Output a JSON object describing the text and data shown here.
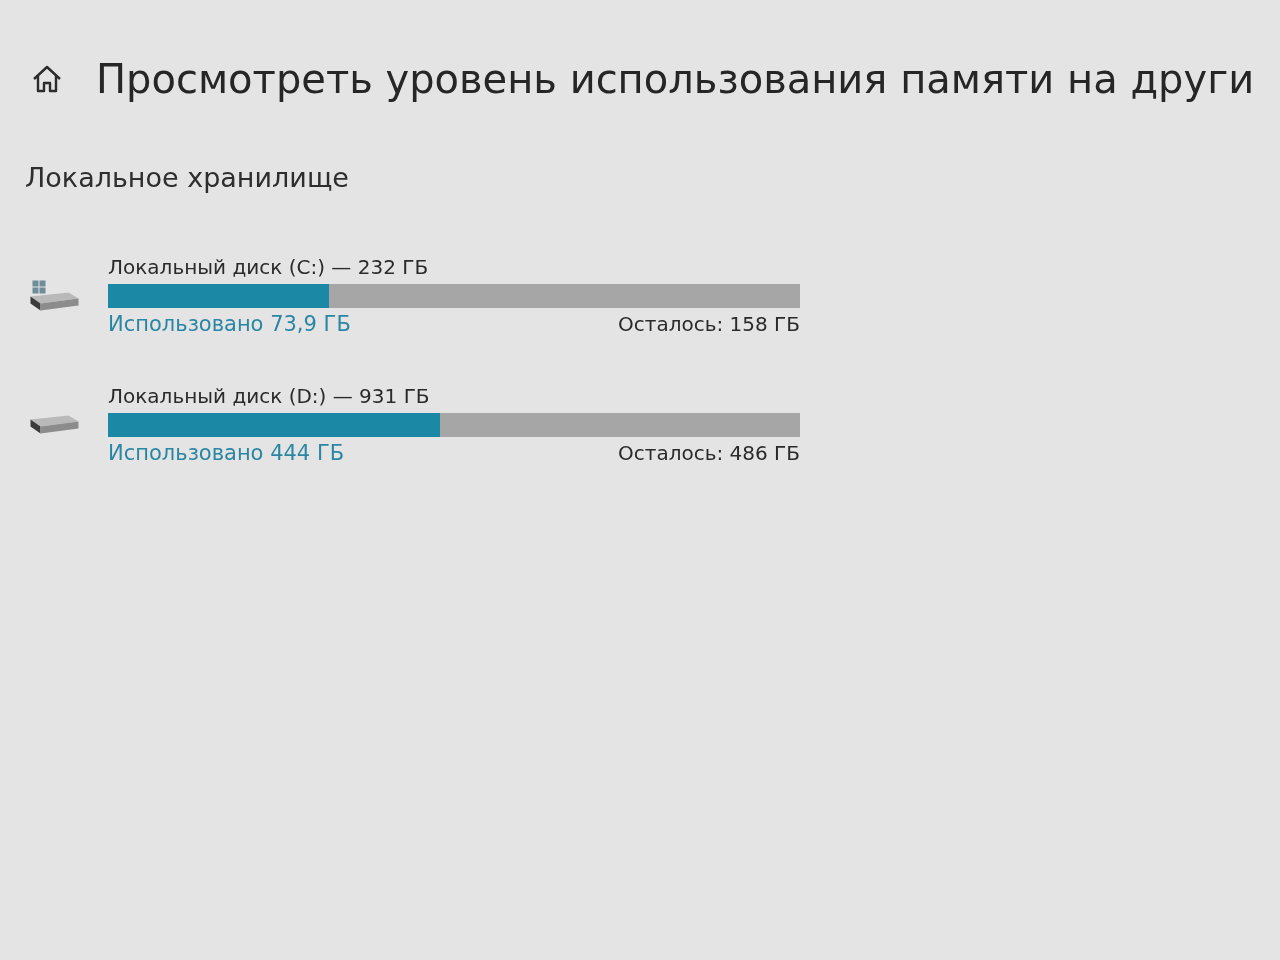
{
  "header": {
    "title": "Просмотреть уровень использования памяти на други"
  },
  "section": {
    "heading": "Локальное хранилище"
  },
  "drives": [
    {
      "kind": "system",
      "name": "Локальный диск (C:) — 232 ГБ",
      "level": 0.32,
      "used": "Использовано 73,9 ГБ",
      "remaining": "Осталось: 158 ГБ"
    },
    {
      "kind": "data",
      "name": "Локальный диск (D:) — 931 ГБ",
      "level": 0.48,
      "used": "Использовано 444 ГБ",
      "remaining": "Осталось: 486 ГБ"
    }
  ]
}
